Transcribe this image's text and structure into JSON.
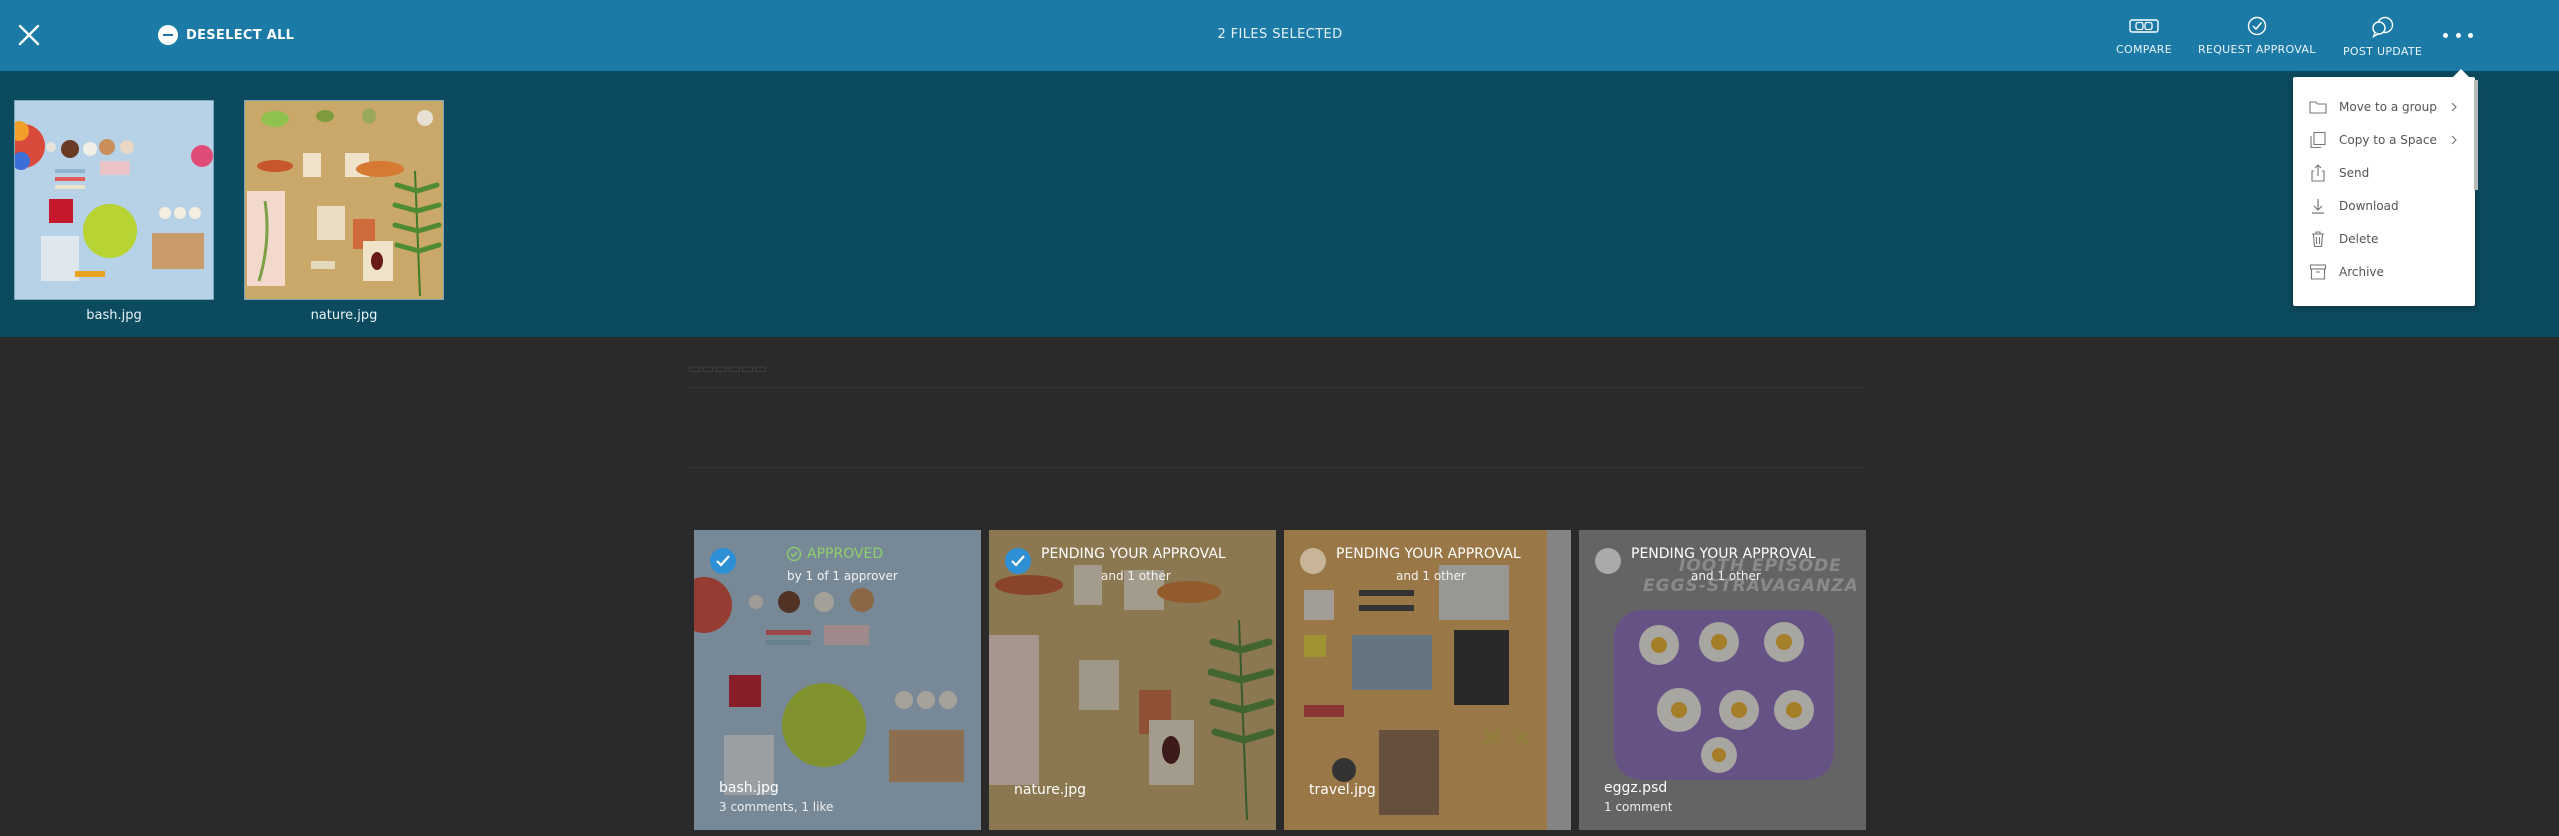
{
  "topbar": {
    "deselect_label": "DESELECT ALL",
    "selection_count": "2 FILES SELECTED",
    "tools": [
      {
        "label": "COMPARE",
        "icon": "compare-icon"
      },
      {
        "label": "REQUEST APPROVAL",
        "icon": "check-circle-icon"
      },
      {
        "label": "POST UPDATE",
        "icon": "chat-bubbles-icon"
      }
    ]
  },
  "tray": {
    "items": [
      {
        "name": "bash.jpg"
      },
      {
        "name": "nature.jpg"
      }
    ]
  },
  "cards": [
    {
      "name": "bash.jpg",
      "status": "APPROVED",
      "status_sub": "by 1 of 1 approver",
      "meta": "3 comments, 1 like",
      "selected": true
    },
    {
      "name": "nature.jpg",
      "status": "PENDING YOUR APPROVAL",
      "status_sub": "and 1 other",
      "meta": "",
      "selected": true
    },
    {
      "name": "travel.jpg",
      "status": "PENDING YOUR APPROVAL",
      "status_sub": "and 1 other",
      "meta": "",
      "selected": false
    },
    {
      "name": "eggz.psd",
      "status": "PENDING YOUR APPROVAL",
      "status_sub": "and 1 other",
      "meta": "1 comment",
      "selected": false
    }
  ],
  "eggz_art": {
    "line1": "IOOTH EPISODE",
    "line2": "EGGS-STRAVAGANZA"
  },
  "menu": {
    "items": [
      {
        "label": "Move to a group",
        "icon": "move-to-group-icon",
        "submenu": true
      },
      {
        "label": "Copy to a Space",
        "icon": "copy-icon",
        "submenu": true
      },
      {
        "label": "Send",
        "icon": "share-icon",
        "submenu": false
      },
      {
        "label": "Download",
        "icon": "download-icon",
        "submenu": false
      },
      {
        "label": "Delete",
        "icon": "trash-icon",
        "submenu": false
      },
      {
        "label": "Archive",
        "icon": "archive-icon",
        "submenu": false
      }
    ]
  },
  "colors": {
    "topbar": "#1b7aa6",
    "tray": "#0c4b5f",
    "page": "#2a2a2a",
    "approved": "#8fd16a",
    "checkbox": "#2d8fd4"
  }
}
